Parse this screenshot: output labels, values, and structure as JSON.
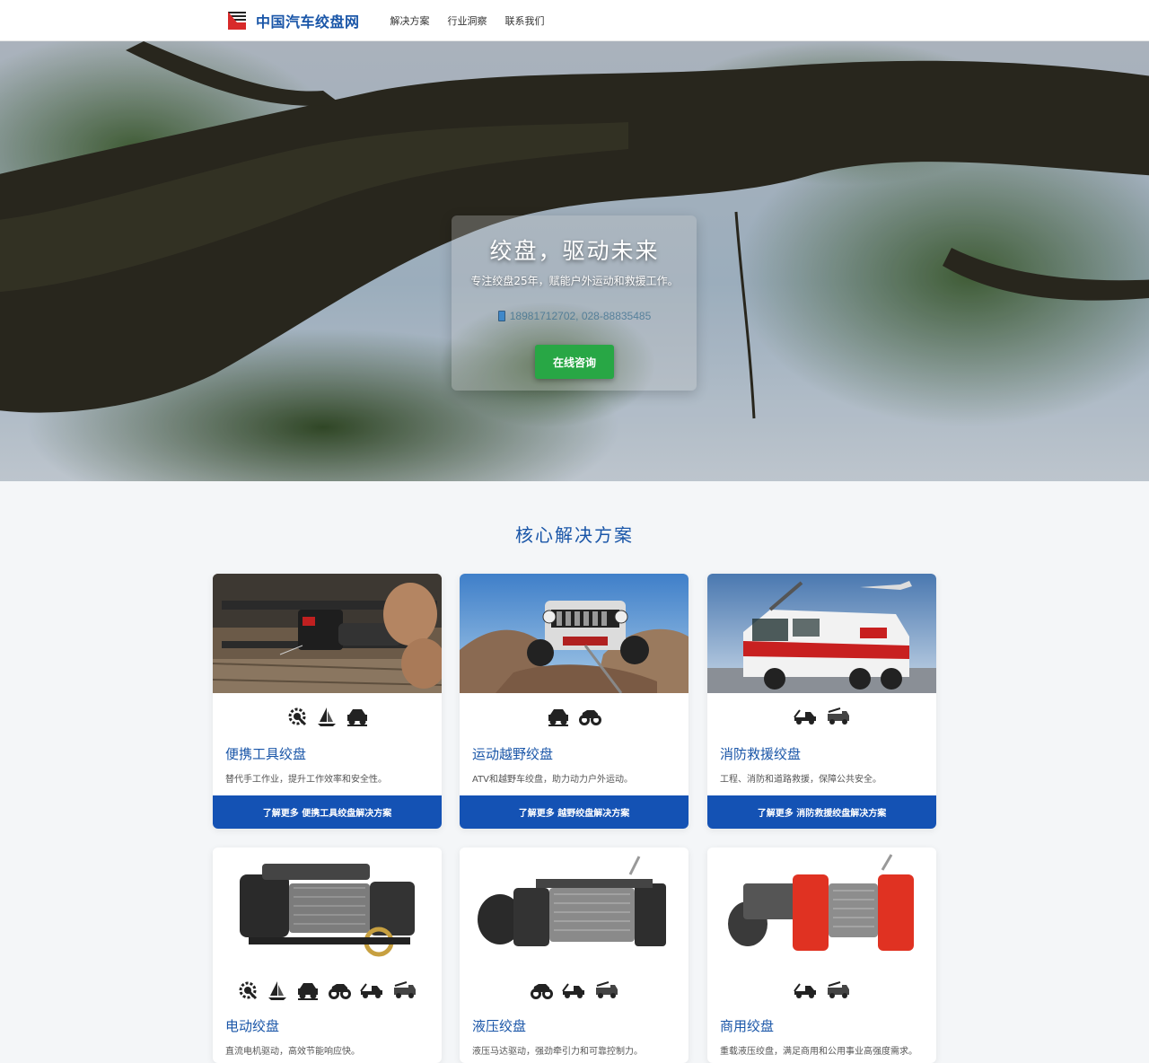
{
  "header": {
    "site_name": "中国汽车绞盘网",
    "nav": [
      "解决方案",
      "行业洞察",
      "联系我们"
    ]
  },
  "hero": {
    "title": "绞盘，驱动未来",
    "subtitle": "专注绞盘25年，赋能户外运动和救援工作。",
    "phone": "18981712702, 028-88835485",
    "cta_label": "在线咨询"
  },
  "section": {
    "title": "核心解决方案"
  },
  "cards": [
    {
      "title": "便携工具绞盘",
      "desc": "替代手工作业，提升工作效率和安全性。",
      "button": "了解更多 便携工具绞盘解决方案",
      "icons": [
        "gear-wrench-icon",
        "sailboat-icon",
        "offroad-suv-icon"
      ]
    },
    {
      "title": "运动越野绞盘",
      "desc": "ATV和越野车绞盘，助力动力户外运动。",
      "button": "了解更多 越野绞盘解决方案",
      "icons": [
        "offroad-suv-icon",
        "atv-icon"
      ]
    },
    {
      "title": "消防救援绞盘",
      "desc": "工程、消防和道路救援，保障公共安全。",
      "button": "了解更多 消防救援绞盘解决方案",
      "icons": [
        "tow-truck-icon",
        "fire-truck-icon"
      ]
    },
    {
      "title": "电动绞盘",
      "desc": "直流电机驱动，高效节能响应快。",
      "icons": [
        "gear-wrench-icon",
        "sailboat-icon",
        "offroad-suv-icon",
        "atv-icon",
        "tow-truck-icon",
        "fire-truck-icon"
      ]
    },
    {
      "title": "液压绞盘",
      "desc": "液压马达驱动，强劲牵引力和可靠控制力。",
      "icons": [
        "atv-icon",
        "tow-truck-icon",
        "fire-truck-icon"
      ]
    },
    {
      "title": "商用绞盘",
      "desc": "重载液压绞盘，满足商用和公用事业高强度需求。",
      "icons": [
        "tow-truck-icon",
        "fire-truck-icon"
      ]
    }
  ],
  "colors": {
    "brand_blue": "#1a56a8",
    "button_blue": "#1452b4",
    "cta_green": "#28a745"
  }
}
